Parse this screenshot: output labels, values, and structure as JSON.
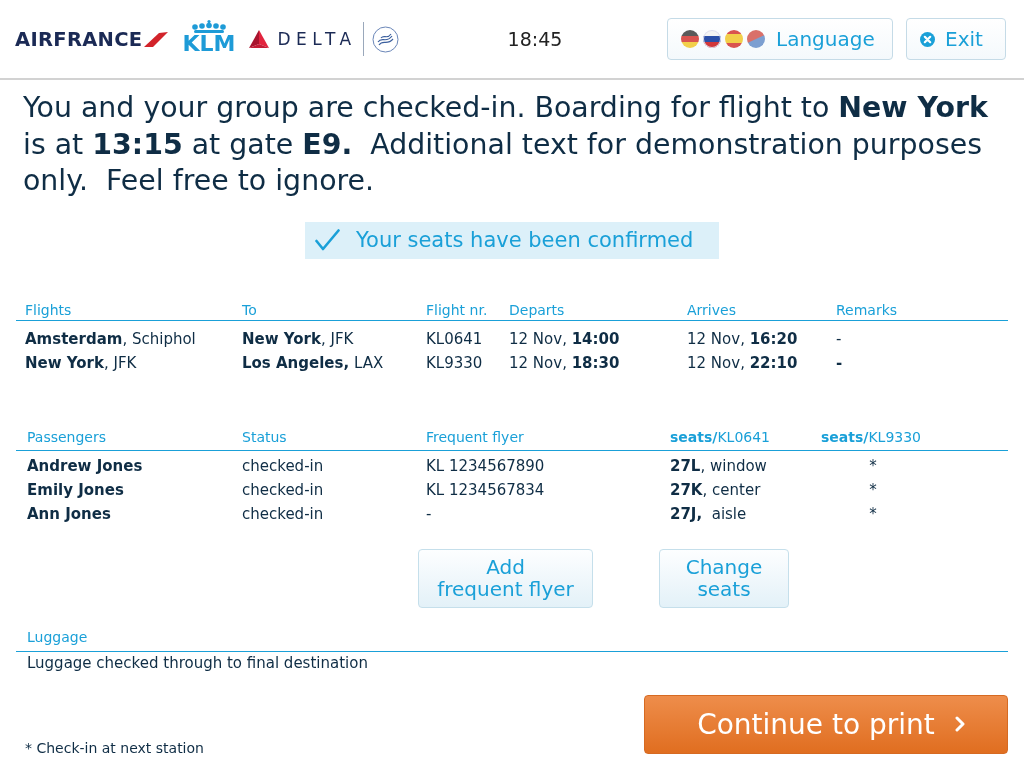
{
  "header": {
    "logos": [
      {
        "kind": "airfrance",
        "text": "AIRFRANCE"
      },
      {
        "kind": "klm",
        "text": "KLM"
      },
      {
        "kind": "delta",
        "text": "DELTA"
      },
      {
        "kind": "skyteam"
      }
    ],
    "clock": "18:45",
    "language_button": "Language",
    "exit_button": "Exit"
  },
  "message": "You and your group are checked-in. Boarding for flight to **New York** is at **13:15** at gate **E9.**  Additional text for demonstration purposes only.  Feel free to ignore.",
  "confirmation": "Your seats have been confirmed",
  "flights": {
    "columns": [
      {
        "label": "Flights",
        "kind": "plain"
      },
      {
        "label": "To",
        "kind": "plain"
      },
      {
        "label": "Flight nr.",
        "kind": "plain"
      },
      {
        "label": "Departs",
        "kind": "plain"
      },
      {
        "label": "Arrives",
        "kind": "plain"
      },
      {
        "label": "Remarks",
        "kind": "plain"
      }
    ],
    "rows": [
      {
        "cells": [
          "**Amsterdam**, Schiphol",
          "**New York**, JFK",
          "KL0641",
          "12 Nov, **14:00**",
          "12 Nov, **16:20**",
          "-"
        ]
      },
      {
        "cells": [
          "**New York**, JFK",
          "**Los Angeles,** LAX",
          "KL9330",
          "12 Nov, **18:30**",
          "12 Nov, **22:10**",
          "**-**"
        ]
      }
    ]
  },
  "passengers": {
    "columns": [
      {
        "label": "Passengers",
        "kind": "strong"
      },
      {
        "label": "Status",
        "kind": "plain"
      },
      {
        "label": "Frequent flyer",
        "kind": "plain"
      },
      {
        "label": "**seats/**KL0641",
        "kind": "plain"
      },
      {
        "label": "**seats/**KL9330",
        "kind": "centered"
      }
    ],
    "rows": [
      {
        "cells": [
          "Andrew Jones",
          "checked-in",
          "KL 1234567890",
          "**27L**, window",
          "*"
        ]
      },
      {
        "cells": [
          "Emily Jones",
          "checked-in",
          "KL 1234567834",
          "**27K**, center",
          "*"
        ]
      },
      {
        "cells": [
          "Ann Jones",
          "checked-in",
          "-",
          "**27J,**  aisle",
          "*"
        ]
      }
    ]
  },
  "actions": [
    {
      "lines": [
        "Add",
        "frequent flyer"
      ]
    },
    {
      "lines": [
        "Change",
        "seats"
      ]
    }
  ],
  "luggage": {
    "heading": "Luggage",
    "text": "Luggage checked through to final destination"
  },
  "footnote": "* Check-in at next station",
  "continue_button": "Continue to print"
}
